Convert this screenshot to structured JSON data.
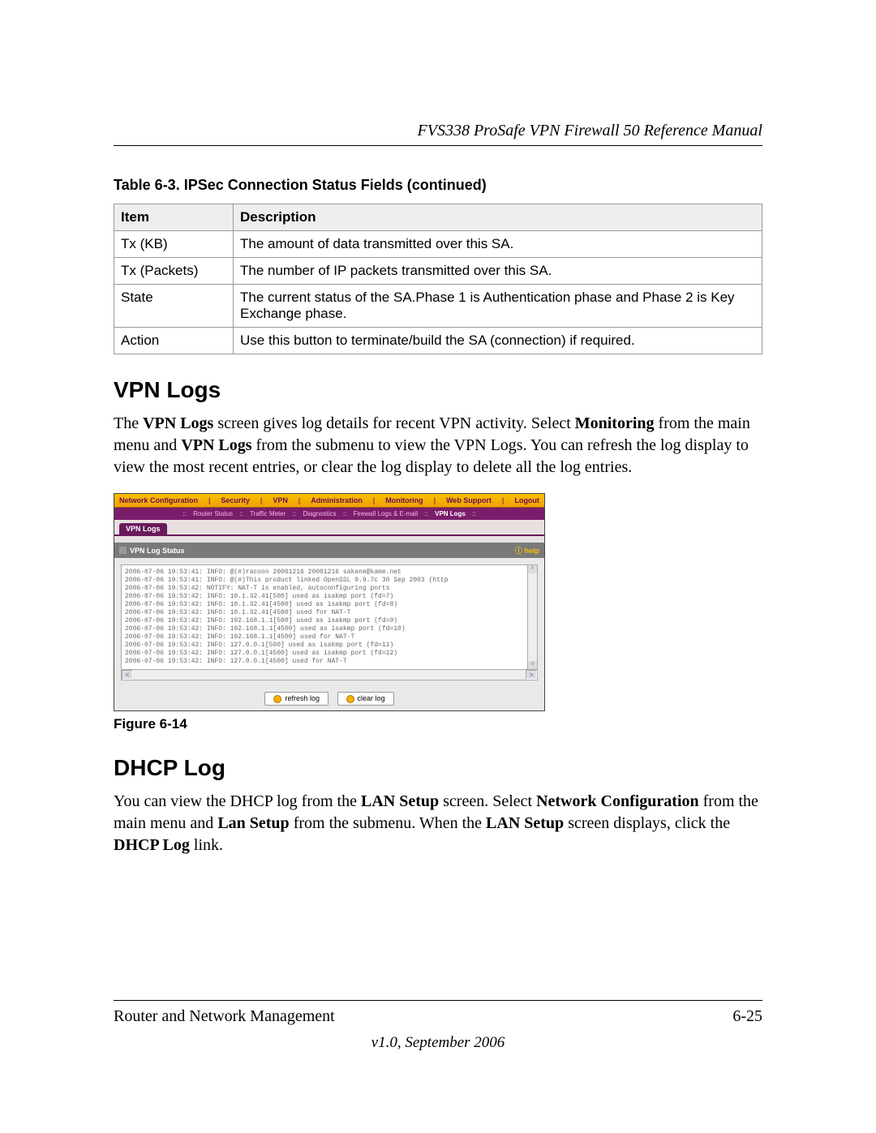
{
  "header": {
    "doc_title": "FVS338 ProSafe VPN Firewall 50 Reference Manual"
  },
  "table": {
    "caption": "Table 6-3.  IPSec Connection Status Fields (continued)",
    "head": {
      "item": "Item",
      "desc": "Description"
    },
    "rows": [
      {
        "item": "Tx (KB)",
        "desc": "The amount of data transmitted over this SA."
      },
      {
        "item": "Tx (Packets)",
        "desc": "The number of IP packets transmitted over this SA."
      },
      {
        "item": "State",
        "desc": "The current status of the SA.Phase 1 is Authentication phase and Phase 2 is Key Exchange phase."
      },
      {
        "item": "Action",
        "desc": "Use this button to terminate/build the SA (connection) if required."
      }
    ]
  },
  "s1": {
    "heading": "VPN Logs",
    "p_pre": "The ",
    "p_b1": "VPN Logs",
    "p_mid1": " screen gives log details for recent VPN activity. Select ",
    "p_b2": "Monitoring",
    "p_mid2": " from the main menu and ",
    "p_b3": "VPN Logs",
    "p_post": " from the submenu to view the VPN Logs. You can refresh the log display to view the most recent entries, or clear the log display to delete all the log entries."
  },
  "figure": {
    "label": "Figure 6-14"
  },
  "app": {
    "nav": [
      "Network Configuration",
      "Security",
      "VPN",
      "Administration",
      "Monitoring",
      "Web Support",
      "Logout"
    ],
    "subnav": [
      "Router Status",
      "Traffic Meter",
      "Diagnostics",
      "Firewall Logs & E-mail",
      "VPN Logs"
    ],
    "tab": "VPN Logs",
    "panel_title": "VPN Log Status",
    "help": "help",
    "log_lines": [
      "2006-07-06 19:53:41: INFO:  @(#)racoon 20001216 20001216 sakane@kame.net",
      "2006-07-06 19:53:41: INFO:  @(#)This product linked OpenSSL 0.9.7c 30 Sep 2003 (http",
      "2006-07-06 19:53:42: NOTIFY:  NAT-T is enabled, autoconfiguring ports",
      "2006-07-06 19:53:42: INFO:  10.1.32.41[500] used as isakmp port (fd=7)",
      "2006-07-06 19:53:42: INFO:  10.1.32.41[4500] used as isakmp port (fd=8)",
      "2006-07-06 19:53:42: INFO:  10.1.32.41[4500] used for NAT-T",
      "2006-07-06 19:53:42: INFO:  192.168.1.1[500] used as isakmp port (fd=9)",
      "2006-07-06 19:53:42: INFO:  192.168.1.1[4500] used as isakmp port (fd=10)",
      "2006-07-06 19:53:42: INFO:  192.168.1.1[4500] used for NAT-T",
      "2006-07-06 19:53:42: INFO:  127.0.0.1[500] used as isakmp port (fd=11)",
      "2006-07-06 19:53:42: INFO:  127.0.0.1[4500] used as isakmp port (fd=12)",
      "2006-07-06 19:53:42: INFO:  127.0.0.1[4500] used for NAT-T"
    ],
    "btn_refresh": "refresh log",
    "btn_clear": "clear log"
  },
  "s2": {
    "heading": "DHCP Log",
    "p_pre": "You can view the DHCP log from the ",
    "p_b1": "LAN Setup",
    "p_mid1": " screen. Select ",
    "p_b2": "Network Configuration",
    "p_mid2": " from the main menu and ",
    "p_b3": "Lan Setup",
    "p_mid3": " from the submenu. When the ",
    "p_b4": "LAN Setup",
    "p_mid4": " screen displays, click the ",
    "p_b5": "DHCP Log",
    "p_post": " link."
  },
  "footer": {
    "left": "Router and Network Management",
    "right": "6-25",
    "version": "v1.0, September 2006"
  }
}
